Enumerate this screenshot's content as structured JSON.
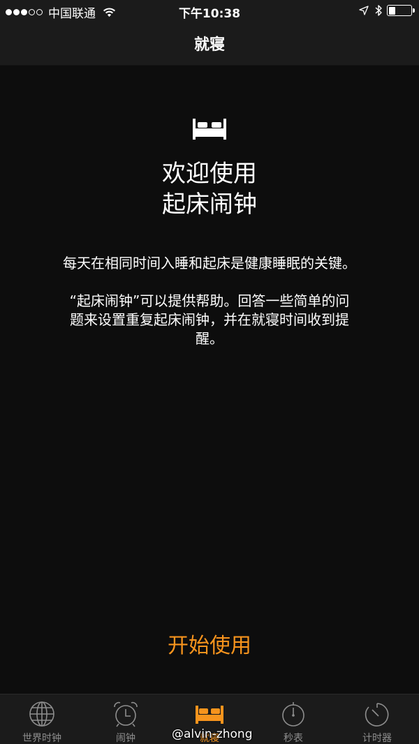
{
  "status_bar": {
    "carrier": "中国联通",
    "time": "下午10:38"
  },
  "nav": {
    "title": "就寝"
  },
  "welcome": {
    "line1": "欢迎使用",
    "line2": "起床闹钟"
  },
  "description": {
    "para1": "每天在相同时间入睡和起床是健康睡眠的关键。",
    "para2": "“起床闹钟”可以提供帮助。回答一些简单的问题来设置重复起床闹钟，并在就寝时间收到提醒。"
  },
  "start_button": {
    "label": "开始使用"
  },
  "tabs": [
    {
      "label": "世界时钟",
      "icon": "globe-icon"
    },
    {
      "label": "闹钟",
      "icon": "alarm-clock-icon"
    },
    {
      "label": "就寝",
      "icon": "bed-icon"
    },
    {
      "label": "秒表",
      "icon": "stopwatch-icon"
    },
    {
      "label": "计时器",
      "icon": "timer-icon"
    }
  ],
  "watermark": "@alvin-zhong",
  "colors": {
    "accent": "#f7941d",
    "background": "#0d0d0d",
    "bar": "#1b1b1b",
    "inactive": "#8e8e8e"
  }
}
